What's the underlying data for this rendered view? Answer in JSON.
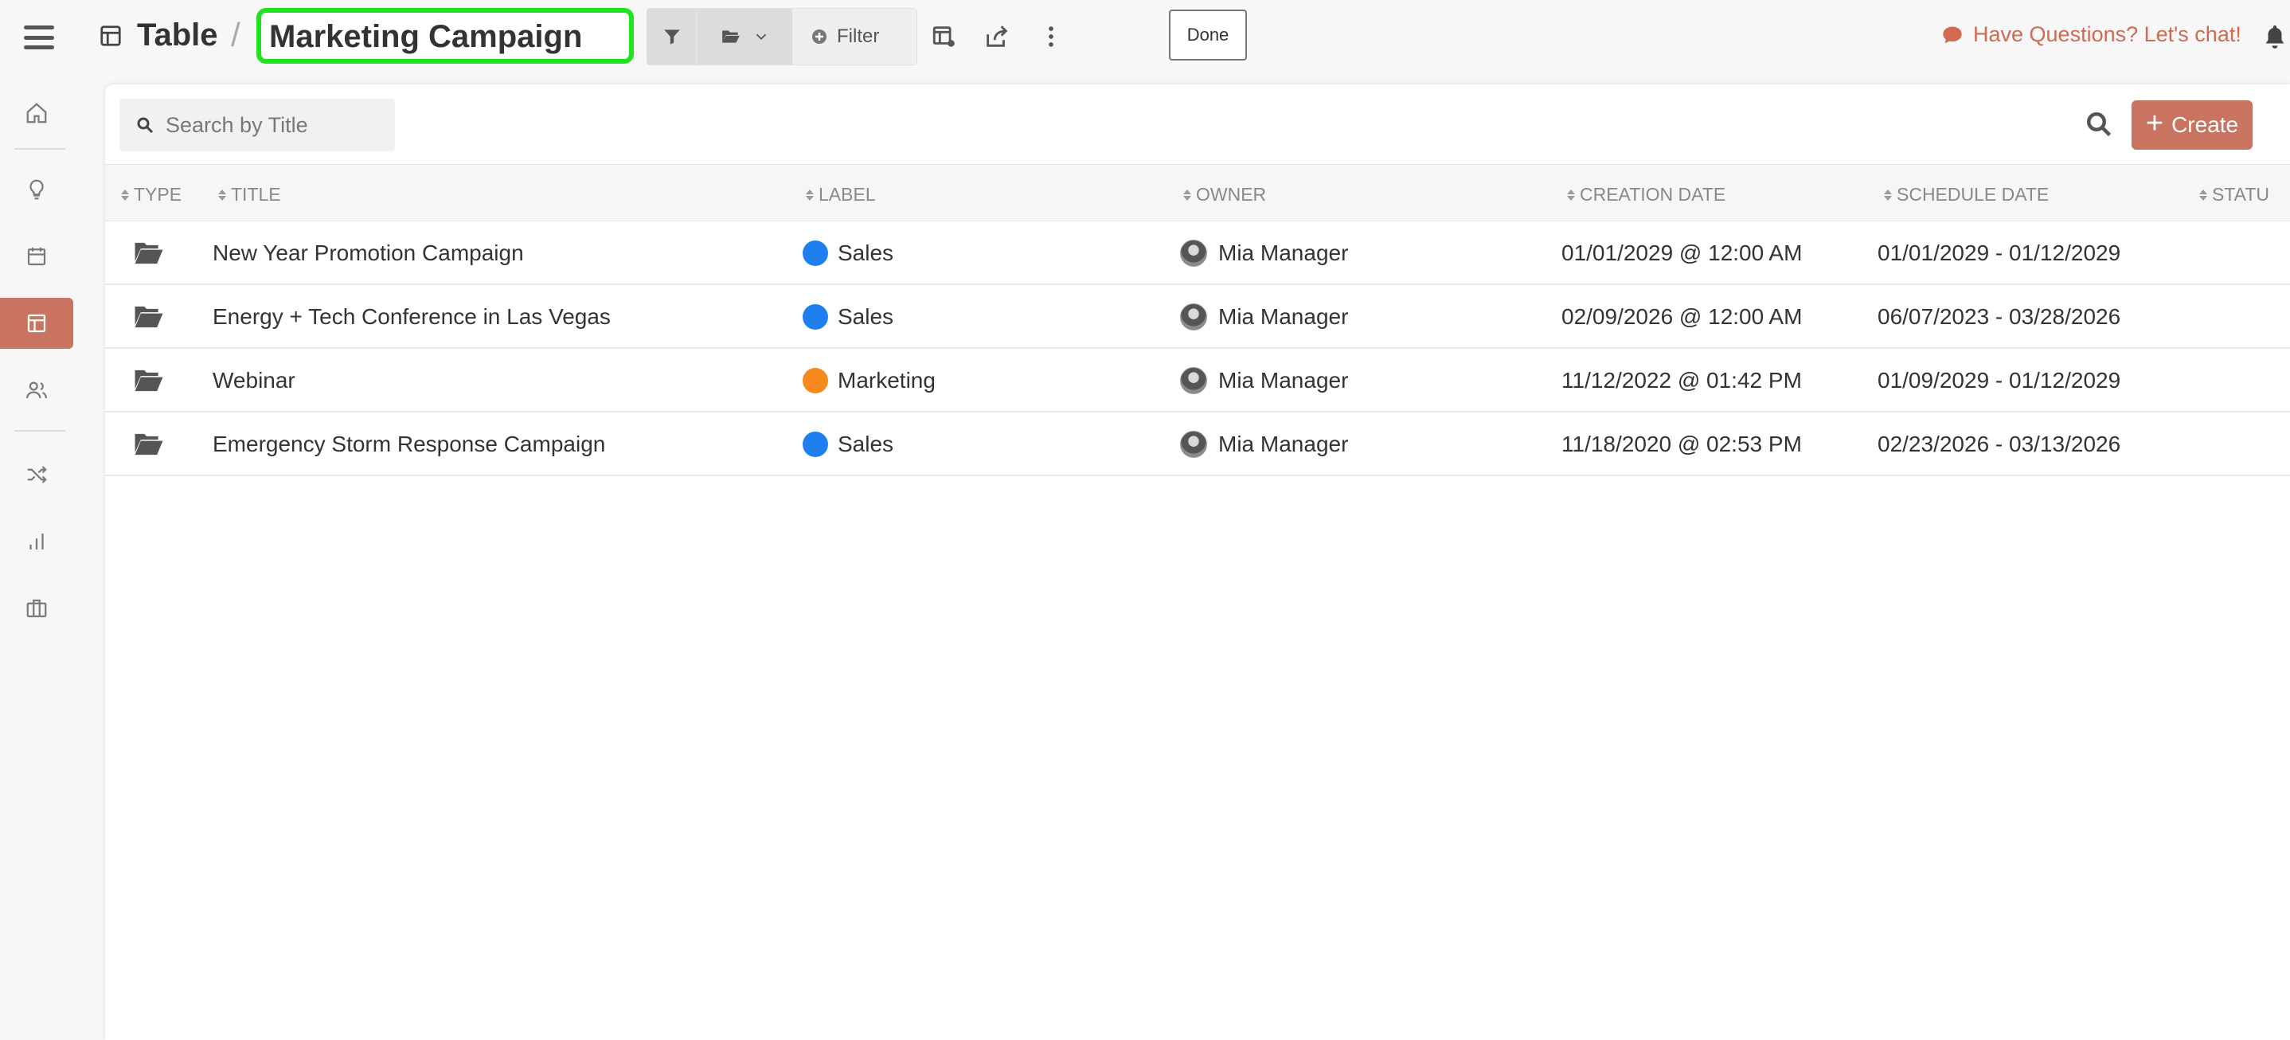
{
  "sidebar": {
    "items": [
      {
        "name": "home",
        "icon": "home-icon"
      },
      {
        "name": "ideas",
        "icon": "lightbulb-icon"
      },
      {
        "name": "calendar",
        "icon": "calendar-icon"
      },
      {
        "name": "table",
        "icon": "table-icon",
        "active": true
      },
      {
        "name": "people",
        "icon": "users-icon"
      },
      {
        "name": "workflow",
        "icon": "shuffle-icon"
      },
      {
        "name": "analytics",
        "icon": "bar-chart-icon"
      },
      {
        "name": "assets",
        "icon": "briefcase-icon"
      }
    ]
  },
  "breadcrumb": {
    "root": "Table",
    "separator": "/",
    "current": "Marketing Campaign"
  },
  "toolbar": {
    "filter_label": "Filter",
    "done_label": "Done"
  },
  "header": {
    "chat_link": "Have Questions? Let's chat!"
  },
  "search": {
    "placeholder": "Search by Title"
  },
  "create_label": "Create",
  "table": {
    "columns": [
      "TYPE",
      "TITLE",
      "LABEL",
      "OWNER",
      "CREATION DATE",
      "SCHEDULE DATE",
      "STATU"
    ],
    "rows": [
      {
        "title": "New Year Promotion Campaign",
        "label": "Sales",
        "label_color": "#1f7ff0",
        "owner": "Mia Manager",
        "created": "01/01/2029 @ 12:00 AM",
        "schedule": "01/01/2029 - 01/12/2029"
      },
      {
        "title": "Energy + Tech Conference in Las Vegas",
        "label": "Sales",
        "label_color": "#1f7ff0",
        "owner": "Mia Manager",
        "created": "02/09/2026 @ 12:00 AM",
        "schedule": "06/07/2023 - 03/28/2026"
      },
      {
        "title": "Webinar",
        "label": "Marketing",
        "label_color": "#f78a1d",
        "owner": "Mia Manager",
        "created": "11/12/2022 @ 01:42 PM",
        "schedule": "01/09/2029 - 01/12/2029"
      },
      {
        "title": "Emergency Storm Response Campaign",
        "label": "Sales",
        "label_color": "#1f7ff0",
        "owner": "Mia Manager",
        "created": "11/18/2020 @ 02:53 PM",
        "schedule": "02/23/2026 - 03/13/2026"
      }
    ]
  },
  "colors": {
    "accent": "#c87461",
    "highlight_border": "#1fe31f",
    "chat_link": "#d06a52"
  }
}
